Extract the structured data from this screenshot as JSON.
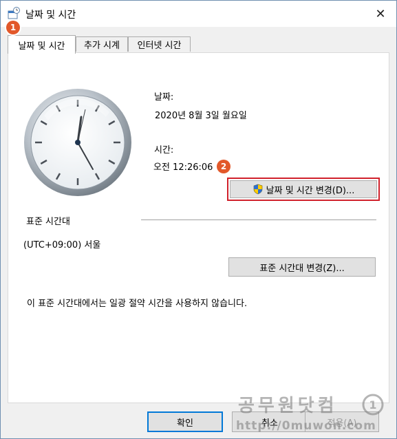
{
  "window": {
    "title": "날짜 및 시간",
    "close_glyph": "✕"
  },
  "badges": {
    "first": "1",
    "second": "2"
  },
  "tabs": [
    {
      "label": "날짜 및 시간"
    },
    {
      "label": "추가 시계"
    },
    {
      "label": "인터넷 시간"
    }
  ],
  "date": {
    "label": "날짜:",
    "value": "2020년 8월 3일 월요일"
  },
  "time": {
    "label": "시간:",
    "value": "오전 12:26:06"
  },
  "change_datetime_button": "날짜 및 시간 변경(D)...",
  "timezone": {
    "heading": "표준 시간대",
    "value": "(UTC+09:00) 서울",
    "change_button": "표준 시간대 변경(Z)...",
    "dst_note": "이 표준 시간대에서는 일광 절약 시간을 사용하지 않습니다."
  },
  "footer": {
    "ok": "확인",
    "cancel": "취소",
    "apply": "적용(A)"
  },
  "watermark": {
    "line1": "공무원닷컴",
    "line2": "http://0muwon.com"
  },
  "colors": {
    "badge": "#e2582a",
    "highlight_border": "#d0202a",
    "primary_border": "#0078d7"
  }
}
